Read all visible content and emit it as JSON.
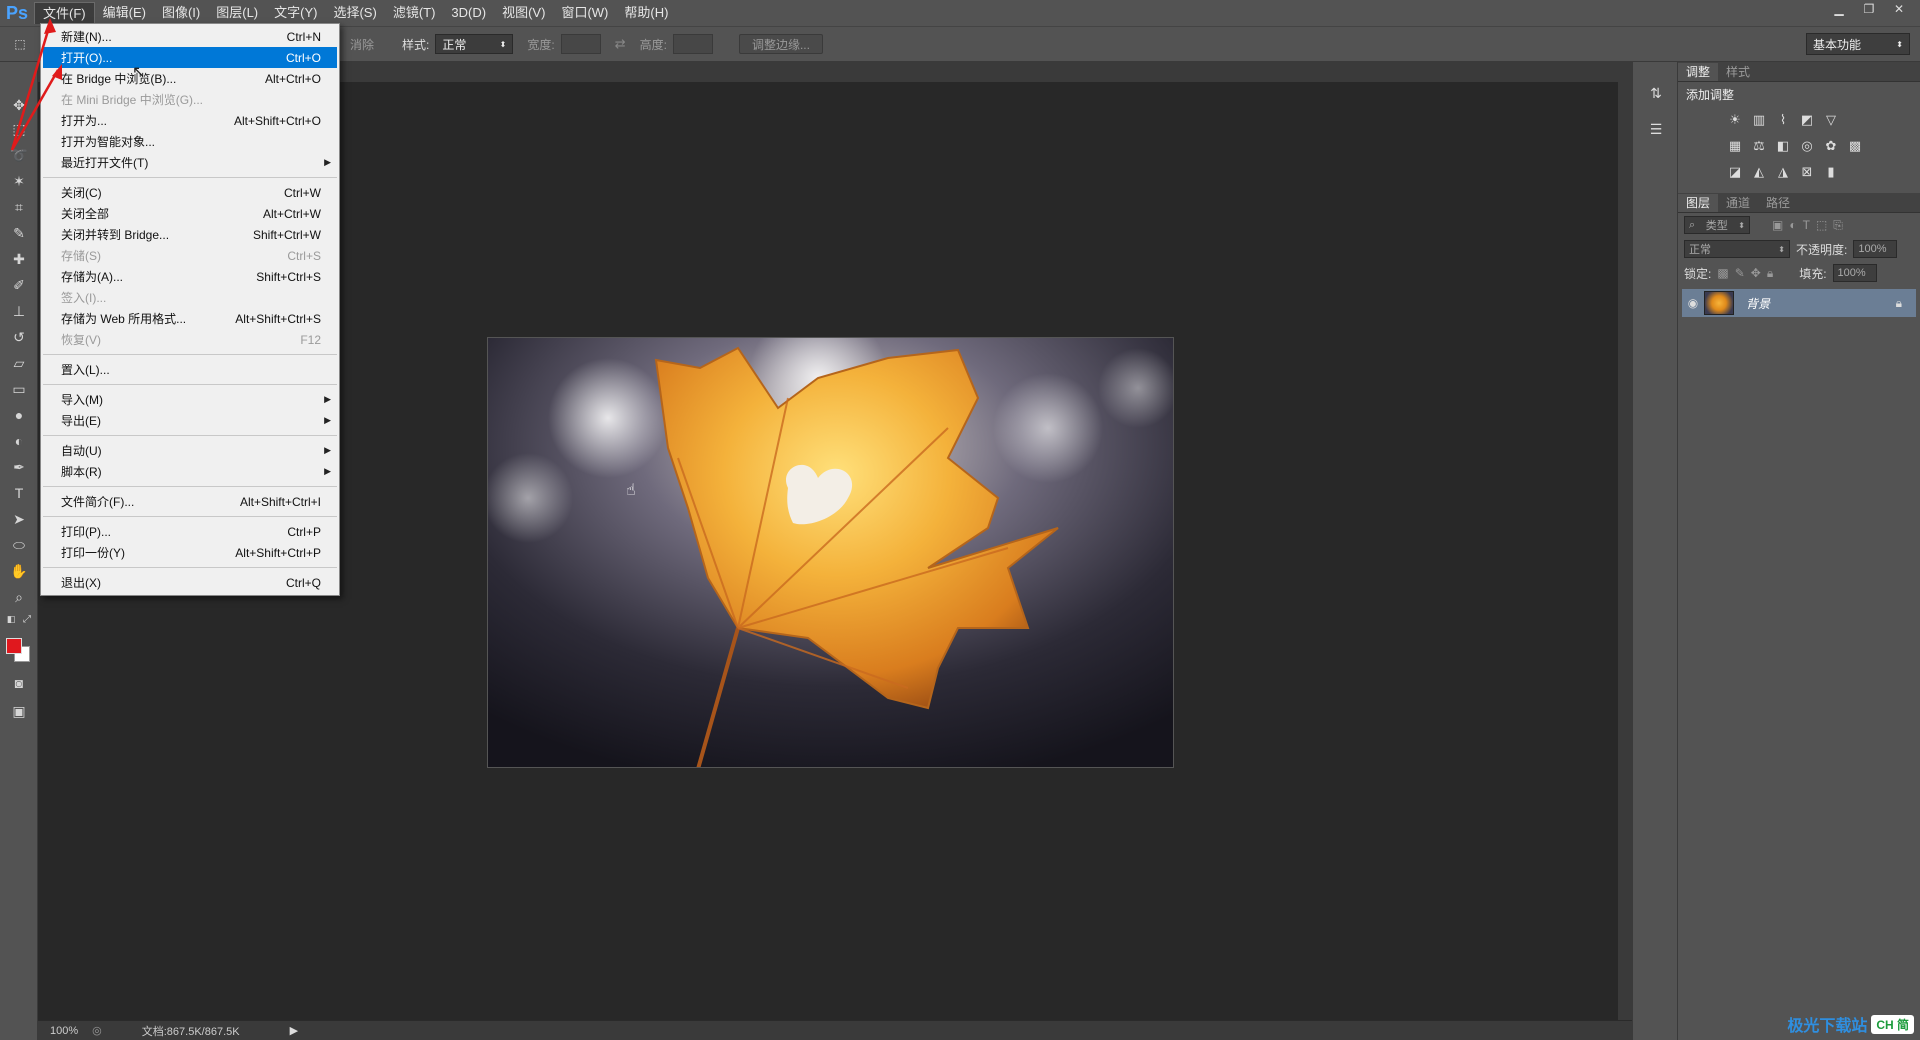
{
  "app": {
    "logo": "Ps"
  },
  "menubar": {
    "items": [
      "文件(F)",
      "编辑(E)",
      "图像(I)",
      "图层(L)",
      "文字(Y)",
      "选择(S)",
      "滤镜(T)",
      "3D(D)",
      "视图(V)",
      "窗口(W)",
      "帮助(H)"
    ],
    "active_index": 0
  },
  "options": {
    "edge_partial": "消除",
    "style_label": "样式:",
    "style_value": "正常",
    "width_label": "宽度:",
    "height_label": "高度:",
    "refine_edge": "调整边缘...",
    "workspace": "基本功能"
  },
  "file_menu": {
    "items": [
      {
        "label": "新建(N)...",
        "shortcut": "Ctrl+N"
      },
      {
        "label": "打开(O)...",
        "shortcut": "Ctrl+O",
        "highlight": true
      },
      {
        "label": "在 Bridge 中浏览(B)...",
        "shortcut": "Alt+Ctrl+O"
      },
      {
        "label": "在 Mini Bridge 中浏览(G)...",
        "shortcut": "",
        "disabled": true
      },
      {
        "label": "打开为...",
        "shortcut": "Alt+Shift+Ctrl+O"
      },
      {
        "label": "打开为智能对象...",
        "shortcut": ""
      },
      {
        "label": "最近打开文件(T)",
        "shortcut": "",
        "submenu": true
      },
      {
        "sep": true
      },
      {
        "label": "关闭(C)",
        "shortcut": "Ctrl+W"
      },
      {
        "label": "关闭全部",
        "shortcut": "Alt+Ctrl+W"
      },
      {
        "label": "关闭并转到 Bridge...",
        "shortcut": "Shift+Ctrl+W"
      },
      {
        "label": "存储(S)",
        "shortcut": "Ctrl+S",
        "disabled": true
      },
      {
        "label": "存储为(A)...",
        "shortcut": "Shift+Ctrl+S"
      },
      {
        "label": "签入(I)...",
        "shortcut": "",
        "disabled": true
      },
      {
        "label": "存储为 Web 所用格式...",
        "shortcut": "Alt+Shift+Ctrl+S"
      },
      {
        "label": "恢复(V)",
        "shortcut": "F12",
        "disabled": true
      },
      {
        "sep": true
      },
      {
        "label": "置入(L)...",
        "shortcut": ""
      },
      {
        "sep": true
      },
      {
        "label": "导入(M)",
        "shortcut": "",
        "submenu": true
      },
      {
        "label": "导出(E)",
        "shortcut": "",
        "submenu": true
      },
      {
        "sep": true
      },
      {
        "label": "自动(U)",
        "shortcut": "",
        "submenu": true
      },
      {
        "label": "脚本(R)",
        "shortcut": "",
        "submenu": true
      },
      {
        "sep": true
      },
      {
        "label": "文件简介(F)...",
        "shortcut": "Alt+Shift+Ctrl+I"
      },
      {
        "sep": true
      },
      {
        "label": "打印(P)...",
        "shortcut": "Ctrl+P"
      },
      {
        "label": "打印一份(Y)",
        "shortcut": "Alt+Shift+Ctrl+P"
      },
      {
        "sep": true
      },
      {
        "label": "退出(X)",
        "shortcut": "Ctrl+Q"
      }
    ]
  },
  "status": {
    "zoom": "100%",
    "doc_info": "文档:867.5K/867.5K"
  },
  "panels": {
    "adjust_tabs": [
      "调整",
      "样式"
    ],
    "adjust_title": "添加调整",
    "layer_tabs": [
      "图层",
      "通道",
      "路径"
    ],
    "kind_filter": "类型",
    "blend_mode": "正常",
    "opacity_label": "不透明度:",
    "opacity_value": "100%",
    "lock_label": "锁定:",
    "fill_label": "填充:",
    "fill_value": "100%",
    "layer_name": "背景"
  },
  "watermark": {
    "text": "极光下载站",
    "sub": "CH 简"
  },
  "colors": {
    "foreground": "#e0181e",
    "background": "#ffffff",
    "highlight": "#0078d7"
  }
}
